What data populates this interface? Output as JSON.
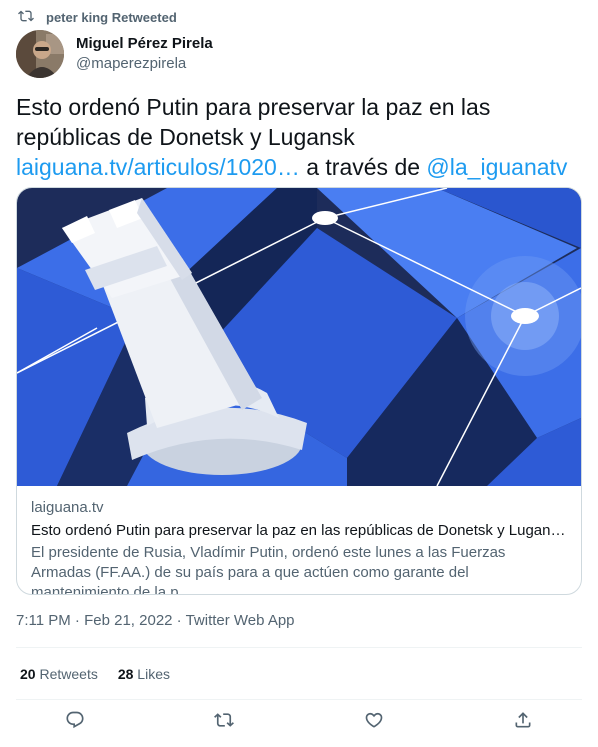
{
  "retweet_context": {
    "text": "peter king Retweeted"
  },
  "author": {
    "display_name": "Miguel Pérez Pirela",
    "handle": "@maperezpirela"
  },
  "tweet": {
    "text_main": "Esto ordenó Putin para preservar la paz en las repúblicas de Donetsk y Lugansk",
    "link_text": "laiguana.tv/articulos/1020…",
    "text_via": " a través de ",
    "mention": "@la_iguanatv"
  },
  "card": {
    "domain": "laiguana.tv",
    "title": "Esto ordenó Putin para preservar la paz en las repúblicas de Donetsk y Lugansk…",
    "description": "El presidente de Rusia, Vladímir Putin, ordenó este lunes a las Fuerzas Armadas (FF.AA.) de su país para a que actúen como garante del mantenimiento de la p…"
  },
  "meta": {
    "time": "7:11 PM",
    "date": "Feb 21, 2022",
    "source": "Twitter Web App",
    "sep": " · "
  },
  "stats": {
    "retweets_count": "20",
    "retweets_label": "Retweets",
    "likes_count": "28",
    "likes_label": "Likes"
  },
  "actions": [
    "reply-icon",
    "retweet-icon",
    "like-icon",
    "share-icon"
  ],
  "colors": {
    "link": "#1d9bf0",
    "secondary": "#536471",
    "border": "#cfd9de"
  }
}
